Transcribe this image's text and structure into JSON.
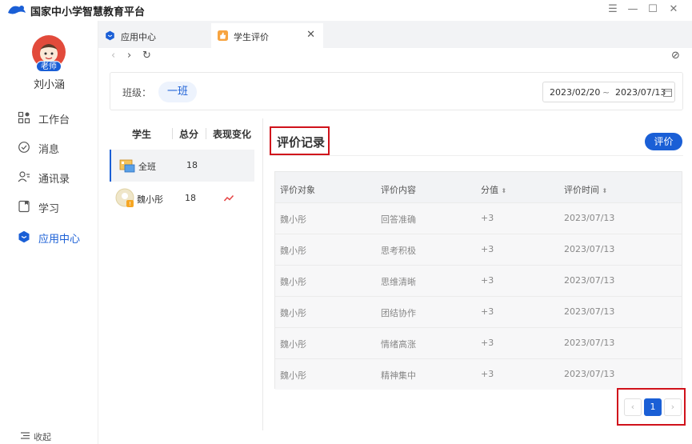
{
  "app": {
    "title": "国家中小学智慧教育平台"
  },
  "sidebar": {
    "badge": "老师",
    "username": "刘小涵",
    "items": [
      {
        "label": "工作台",
        "icon": "grid-icon"
      },
      {
        "label": "消息",
        "icon": "message-icon"
      },
      {
        "label": "通讯录",
        "icon": "contacts-icon"
      },
      {
        "label": "学习",
        "icon": "study-icon"
      },
      {
        "label": "应用中心",
        "icon": "app-center-icon"
      }
    ],
    "collapse_label": "收起"
  },
  "tabs": [
    {
      "label": "应用中心"
    },
    {
      "label": "学生评价",
      "close": "✕"
    }
  ],
  "filter": {
    "class_label": "班级：",
    "class_value": "一班",
    "date_start": "2023/02/20",
    "date_sep": "~",
    "date_end": "2023/07/13"
  },
  "students": {
    "headers": {
      "student": "学生",
      "score": "总分",
      "change": "表现变化"
    },
    "rows": [
      {
        "name": "全班",
        "score": "18"
      },
      {
        "name": "魏小彤",
        "score": "18"
      }
    ]
  },
  "records": {
    "title": "评价记录",
    "evaluate_button": "评价",
    "columns": [
      "评价对象",
      "评价内容",
      "分值",
      "评价时间"
    ],
    "rows": [
      [
        "魏小彤",
        "回答准确",
        "+3",
        "2023/07/13"
      ],
      [
        "魏小彤",
        "思考积极",
        "+3",
        "2023/07/13"
      ],
      [
        "魏小彤",
        "思维清晰",
        "+3",
        "2023/07/13"
      ],
      [
        "魏小彤",
        "团结协作",
        "+3",
        "2023/07/13"
      ],
      [
        "魏小彤",
        "情绪高涨",
        "+3",
        "2023/07/13"
      ],
      [
        "魏小彤",
        "精神集中",
        "+3",
        "2023/07/13"
      ]
    ]
  },
  "pagination": {
    "prev": "‹",
    "current": "1",
    "next": "›"
  },
  "colors": {
    "accent": "#1a5fd6",
    "highlight_box": "#d0121b"
  }
}
